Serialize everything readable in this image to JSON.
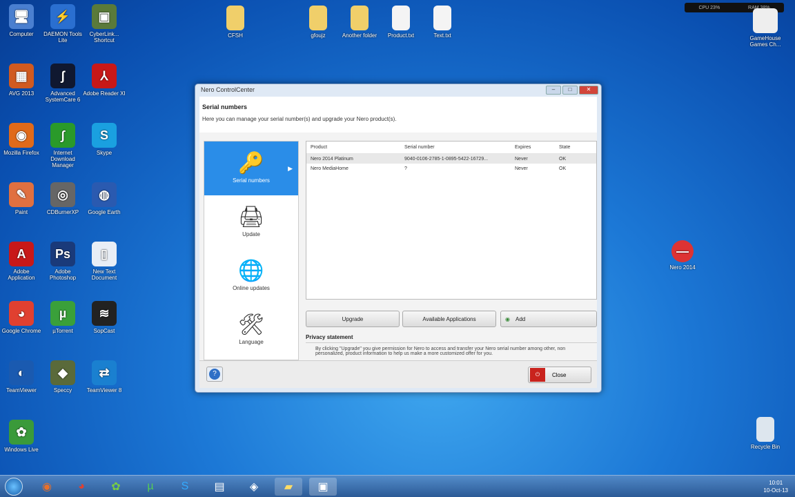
{
  "desktop_icons": [
    {
      "label": "Computer",
      "glyph": "🖥",
      "color": "#4a7fd0"
    },
    {
      "label": "DAEMON Tools Lite",
      "glyph": "⚡",
      "color": "#2a6fd0"
    },
    {
      "label": "CyberLink... Shortcut",
      "glyph": "▣",
      "color": "#5a7a3a"
    },
    {
      "label": "AVG 2013",
      "glyph": "▦",
      "color": "#d05a20"
    },
    {
      "label": "Advanced SystemCare 6",
      "glyph": "ʃ",
      "color": "#101830"
    },
    {
      "label": "Adobe Reader XI",
      "glyph": "⅄",
      "color": "#c81818"
    },
    {
      "label": "Mozilla Firefox",
      "glyph": "◉",
      "color": "#e06a1a"
    },
    {
      "label": "Internet Download Manager",
      "glyph": "∫",
      "color": "#2a9a2a"
    },
    {
      "label": "Skype",
      "glyph": "S",
      "color": "#1aa0e0"
    },
    {
      "label": "Paint",
      "glyph": "✎",
      "color": "#e07040"
    },
    {
      "label": "CDBurnerXP",
      "glyph": "◎",
      "color": "#666"
    },
    {
      "label": "Google Earth",
      "glyph": "◍",
      "color": "#2a5ab0"
    },
    {
      "label": "Adobe Application",
      "glyph": "A",
      "color": "#c81818"
    },
    {
      "label": "Adobe Photoshop",
      "glyph": "Ps",
      "color": "#1a3a7a"
    },
    {
      "label": "New Text Document",
      "glyph": "▯",
      "color": "#e8eef6"
    },
    {
      "label": "Google Chrome",
      "glyph": "◕",
      "color": "#e04030"
    },
    {
      "label": "µTorrent",
      "glyph": "µ",
      "color": "#3aa03a"
    },
    {
      "label": "SopCast",
      "glyph": "≋",
      "color": "#222"
    },
    {
      "label": "TeamViewer",
      "glyph": "◐",
      "color": "#1a5ab0"
    },
    {
      "label": "Speccy",
      "glyph": "◆",
      "color": "#5a6a3a"
    },
    {
      "label": "TeamViewer 8",
      "glyph": "⇄",
      "color": "#1a80d0"
    },
    {
      "label": "Windows Live",
      "glyph": "✿",
      "color": "#3a9a3a"
    }
  ],
  "top_icons": [
    {
      "label": "CFSH"
    },
    {
      "label": "gfoujz"
    },
    {
      "label": "Another folder"
    },
    {
      "label": "Product.txt"
    },
    {
      "label": "Text.txt"
    }
  ],
  "right_icons": {
    "gamehouse": "GameHouse Games Ch...",
    "nero": "Nero 2014",
    "recycle": "Recycle Bin"
  },
  "widget": {
    "left": "CPU 23%",
    "right": "RAM 38%"
  },
  "window": {
    "title": "Nero ControlCenter",
    "heading": "Serial numbers",
    "description": "Here you can manage your serial number(s) and upgrade your Nero product(s).",
    "sidebar": [
      {
        "label": "Serial numbers",
        "glyph": "🔑"
      },
      {
        "label": "Update",
        "glyph": "🖨"
      },
      {
        "label": "Online updates",
        "glyph": "🌐"
      },
      {
        "label": "Language",
        "glyph": "🛠"
      }
    ],
    "columns": [
      "Product",
      "Serial number",
      "Expires",
      "State"
    ],
    "rows": [
      [
        "Nero 2014 Platinum",
        "9040-0106-2785-1-0895-5422-16729...",
        "Never",
        "OK"
      ],
      [
        "Nero MediaHome",
        "?",
        "Never",
        "OK"
      ]
    ],
    "buttons": {
      "upgrade": "Upgrade",
      "available": "Available Applications",
      "add": "Add"
    },
    "privacy_title": "Privacy statement",
    "privacy_text": "By clicking \"Upgrade\" you give permission for Nero to access and transfer your Nero serial number among other, non personalized, product information to help us make a more customized offer for you.",
    "help": "?",
    "close": "Close"
  },
  "clock": {
    "time": "10:01",
    "date": "10-Oct-13"
  }
}
